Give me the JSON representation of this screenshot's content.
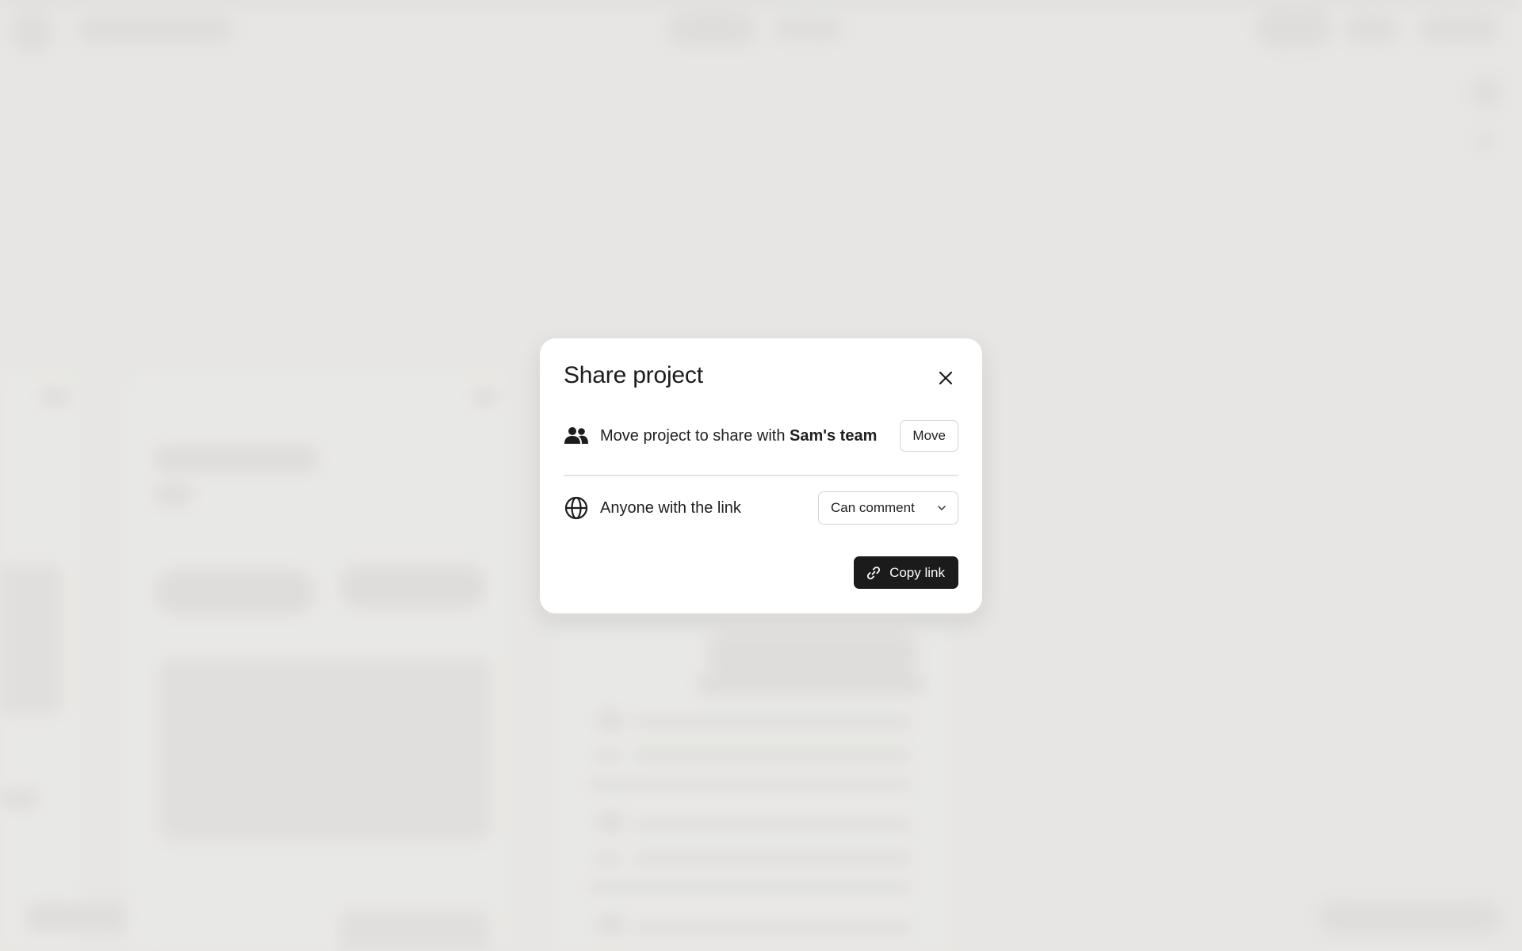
{
  "modal": {
    "title": "Share project",
    "move_row": {
      "text_prefix": "Move project to share with ",
      "team_name": "Sam's team",
      "button_label": "Move",
      "icon": "people-icon"
    },
    "link_row": {
      "text": "Anyone with the link",
      "permission_selected": "Can comment",
      "icon": "globe-icon"
    },
    "copy_button_label": "Copy link",
    "close_icon": "close-icon"
  },
  "colors": {
    "primary_button": "#1b1b1b",
    "backdrop": "#e6e5e3",
    "modal_background": "#ffffff"
  }
}
